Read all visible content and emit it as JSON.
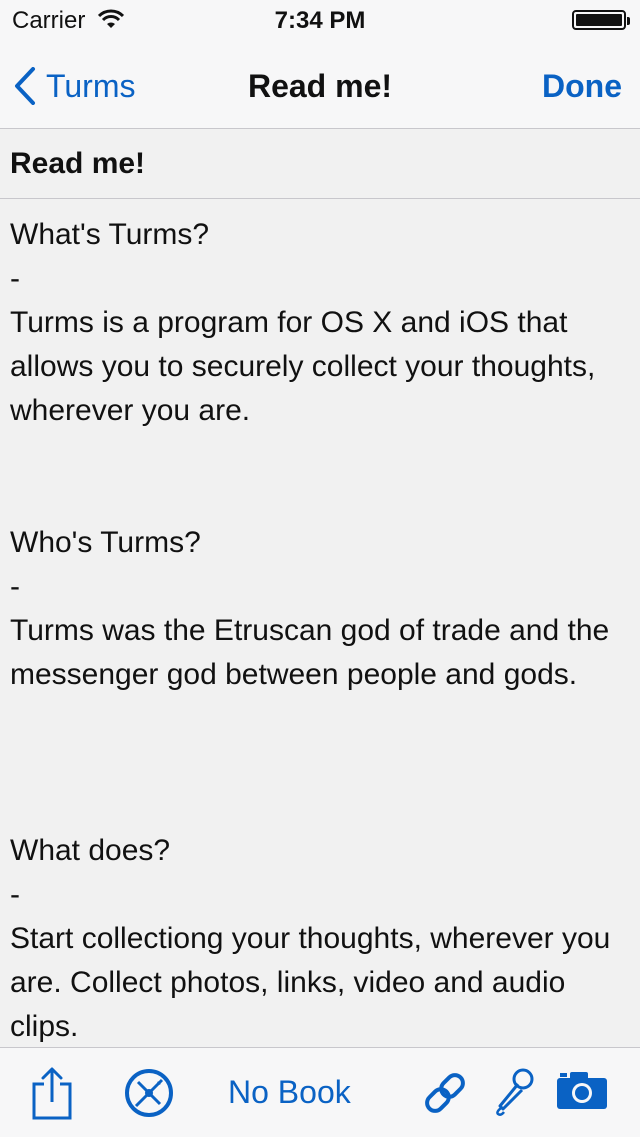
{
  "status_bar": {
    "carrier": "Carrier",
    "time": "7:34 PM"
  },
  "nav": {
    "back_label": "Turms",
    "title": "Read me!",
    "done_label": "Done"
  },
  "document": {
    "title": "Read me!",
    "sections": [
      {
        "heading": "What's Turms?",
        "separator": "-",
        "body": "Turms is a program for OS X and iOS that allows you to securely collect your thoughts, wherever you are."
      },
      {
        "heading": "Who's Turms?",
        "separator": "-",
        "body": "Turms was the Etruscan god of trade and the messenger god between people and gods."
      },
      {
        "heading": "What does?",
        "separator": "-",
        "body": "Start collectiong your thoughts, wherever you are. Collect photos, links, video and audio clips."
      }
    ]
  },
  "toolbar": {
    "share_icon": "share-icon",
    "compass_icon": "compass-icon",
    "book_label": "No Book",
    "link_icon": "link-icon",
    "mic_icon": "microphone-icon",
    "camera_icon": "camera-icon"
  },
  "colors": {
    "accent": "#0a62c4",
    "bar_background": "#f7f7f8",
    "content_background": "#f1f1f1"
  }
}
